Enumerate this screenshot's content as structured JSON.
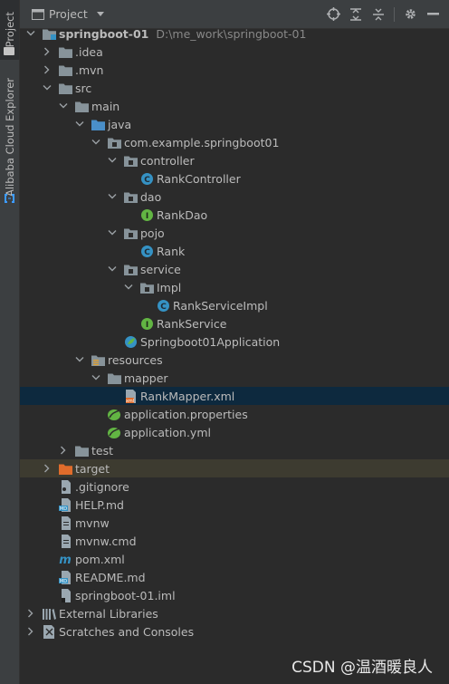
{
  "side_strip": {
    "project_tab": "Project",
    "alibaba_tab": "Alibaba Cloud Explorer"
  },
  "header": {
    "title": "Project",
    "actions": [
      "locate-icon",
      "expand-all-icon",
      "collapse-all-icon",
      "gear-icon",
      "hide-icon"
    ]
  },
  "tree": [
    {
      "label": "springboot-01",
      "path": "D:\\me_work\\springboot-01",
      "depth": 0,
      "arrow": "down",
      "icon": "module-folder",
      "bold": true
    },
    {
      "label": ".idea",
      "depth": 1,
      "arrow": "right",
      "icon": "folder"
    },
    {
      "label": ".mvn",
      "depth": 1,
      "arrow": "right",
      "icon": "folder"
    },
    {
      "label": "src",
      "depth": 1,
      "arrow": "down",
      "icon": "folder"
    },
    {
      "label": "main",
      "depth": 2,
      "arrow": "down",
      "icon": "folder"
    },
    {
      "label": "java",
      "depth": 3,
      "arrow": "down",
      "icon": "source-folder"
    },
    {
      "label": "com.example.springboot01",
      "depth": 4,
      "arrow": "down",
      "icon": "package"
    },
    {
      "label": "controller",
      "depth": 5,
      "arrow": "down",
      "icon": "package"
    },
    {
      "label": "RankController",
      "depth": 6,
      "arrow": "none",
      "icon": "class"
    },
    {
      "label": "dao",
      "depth": 5,
      "arrow": "down",
      "icon": "package"
    },
    {
      "label": "RankDao",
      "depth": 6,
      "arrow": "none",
      "icon": "interface"
    },
    {
      "label": "pojo",
      "depth": 5,
      "arrow": "down",
      "icon": "package"
    },
    {
      "label": "Rank",
      "depth": 6,
      "arrow": "none",
      "icon": "class"
    },
    {
      "label": "service",
      "depth": 5,
      "arrow": "down",
      "icon": "package"
    },
    {
      "label": "Impl",
      "depth": 6,
      "arrow": "down",
      "icon": "package"
    },
    {
      "label": "RankServiceImpl",
      "depth": 7,
      "arrow": "none",
      "icon": "class"
    },
    {
      "label": "RankService",
      "depth": 6,
      "arrow": "none",
      "icon": "interface"
    },
    {
      "label": "Springboot01Application",
      "depth": 5,
      "arrow": "none",
      "icon": "spring-class"
    },
    {
      "label": "resources",
      "depth": 3,
      "arrow": "down",
      "icon": "resources-folder"
    },
    {
      "label": "mapper",
      "depth": 4,
      "arrow": "down",
      "icon": "folder"
    },
    {
      "label": "RankMapper.xml",
      "depth": 5,
      "arrow": "none",
      "icon": "xml",
      "selected": true
    },
    {
      "label": "application.properties",
      "depth": 4,
      "arrow": "none",
      "icon": "spring-config"
    },
    {
      "label": "application.yml",
      "depth": 4,
      "arrow": "none",
      "icon": "spring-config"
    },
    {
      "label": "test",
      "depth": 2,
      "arrow": "right",
      "icon": "folder"
    },
    {
      "label": "target",
      "depth": 1,
      "arrow": "right",
      "icon": "excluded-folder",
      "excluded": true
    },
    {
      "label": ".gitignore",
      "depth": 1,
      "arrow": "none",
      "icon": "gitignore"
    },
    {
      "label": "HELP.md",
      "depth": 1,
      "arrow": "none",
      "icon": "markdown"
    },
    {
      "label": "mvnw",
      "depth": 1,
      "arrow": "none",
      "icon": "text-file"
    },
    {
      "label": "mvnw.cmd",
      "depth": 1,
      "arrow": "none",
      "icon": "text-file"
    },
    {
      "label": "pom.xml",
      "depth": 1,
      "arrow": "none",
      "icon": "maven"
    },
    {
      "label": "README.md",
      "depth": 1,
      "arrow": "none",
      "icon": "markdown"
    },
    {
      "label": "springboot-01.iml",
      "depth": 1,
      "arrow": "none",
      "icon": "iml"
    },
    {
      "label": "External Libraries",
      "depth": 0,
      "arrow": "right",
      "icon": "libraries"
    },
    {
      "label": "Scratches and Consoles",
      "depth": 0,
      "arrow": "right",
      "icon": "scratches"
    }
  ],
  "watermark": "CSDN @温酒暖良人",
  "colors": {
    "background": "#2b2b2b",
    "panel": "#3c3f41",
    "selection": "#0d293e",
    "excluded": "#3d3b30",
    "folder": "#87939a",
    "class": "#3592c4",
    "interface": "#62b543",
    "excluded_folder": "#e06c2b"
  }
}
